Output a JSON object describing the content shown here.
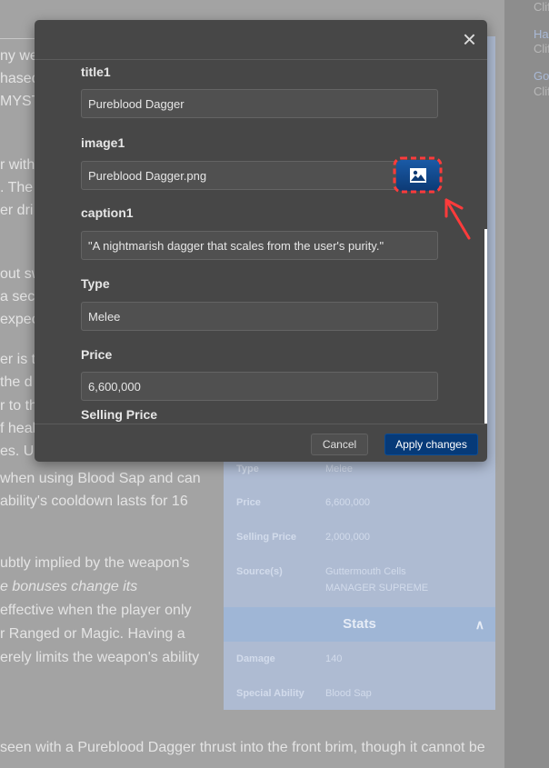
{
  "background": {
    "text_lines": [
      "ny we",
      "hased",
      "MYST",
      "r with",
      ". The j",
      "er dri",
      "out sw",
      "a sec",
      "expec",
      "er is t",
      "the d",
      "r to th",
      "f heal",
      "es. U",
      "when using Blood Sap and can",
      "ability's cooldown lasts for 16",
      "ubtly implied by the weapon's",
      "e bonuses change its",
      "effective when the player only",
      "r Ranged or Magic. Having a",
      "erely limits the weapon's ability",
      "seen with a Pureblood Dagger thrust into the front brim, though it cannot be"
    ],
    "right_links": [
      {
        "text": "Clif",
        "kind": "gray"
      },
      {
        "text": "Ha",
        "kind": "link"
      },
      {
        "text": "Clif",
        "kind": "gray"
      },
      {
        "text": "Go",
        "kind": "link"
      },
      {
        "text": "Clif",
        "kind": "gray"
      }
    ],
    "infobox": {
      "rows": [
        {
          "label": "Type",
          "value": "Melee"
        },
        {
          "label": "Price",
          "value": "6,600,000"
        },
        {
          "label": "Selling Price",
          "value": "2,000,000"
        },
        {
          "label": "Source(s)",
          "value": "Guttermouth Cells",
          "value2": "MANAGER SUPREME"
        }
      ],
      "stats_title": "Stats",
      "stats": [
        {
          "label": "Damage",
          "value": "140"
        },
        {
          "label": "Special Ability",
          "value": "Blood Sap"
        }
      ]
    }
  },
  "modal": {
    "close_icon": "×",
    "fields": [
      {
        "label": "title1",
        "value": "Pureblood Dagger"
      },
      {
        "label": "image1",
        "value": "Pureblood Dagger.png"
      },
      {
        "label": "caption1",
        "value": "\"A nightmarish dagger that scales from the user's purity.\""
      },
      {
        "label": "Type",
        "value": "Melee"
      },
      {
        "label": "Price",
        "value": "6,600,000"
      },
      {
        "label": "Selling Price"
      }
    ],
    "cancel": "Cancel",
    "apply": "Apply changes"
  },
  "colors": {
    "accent": "#063a78",
    "annotation": "#ff3b3b"
  }
}
